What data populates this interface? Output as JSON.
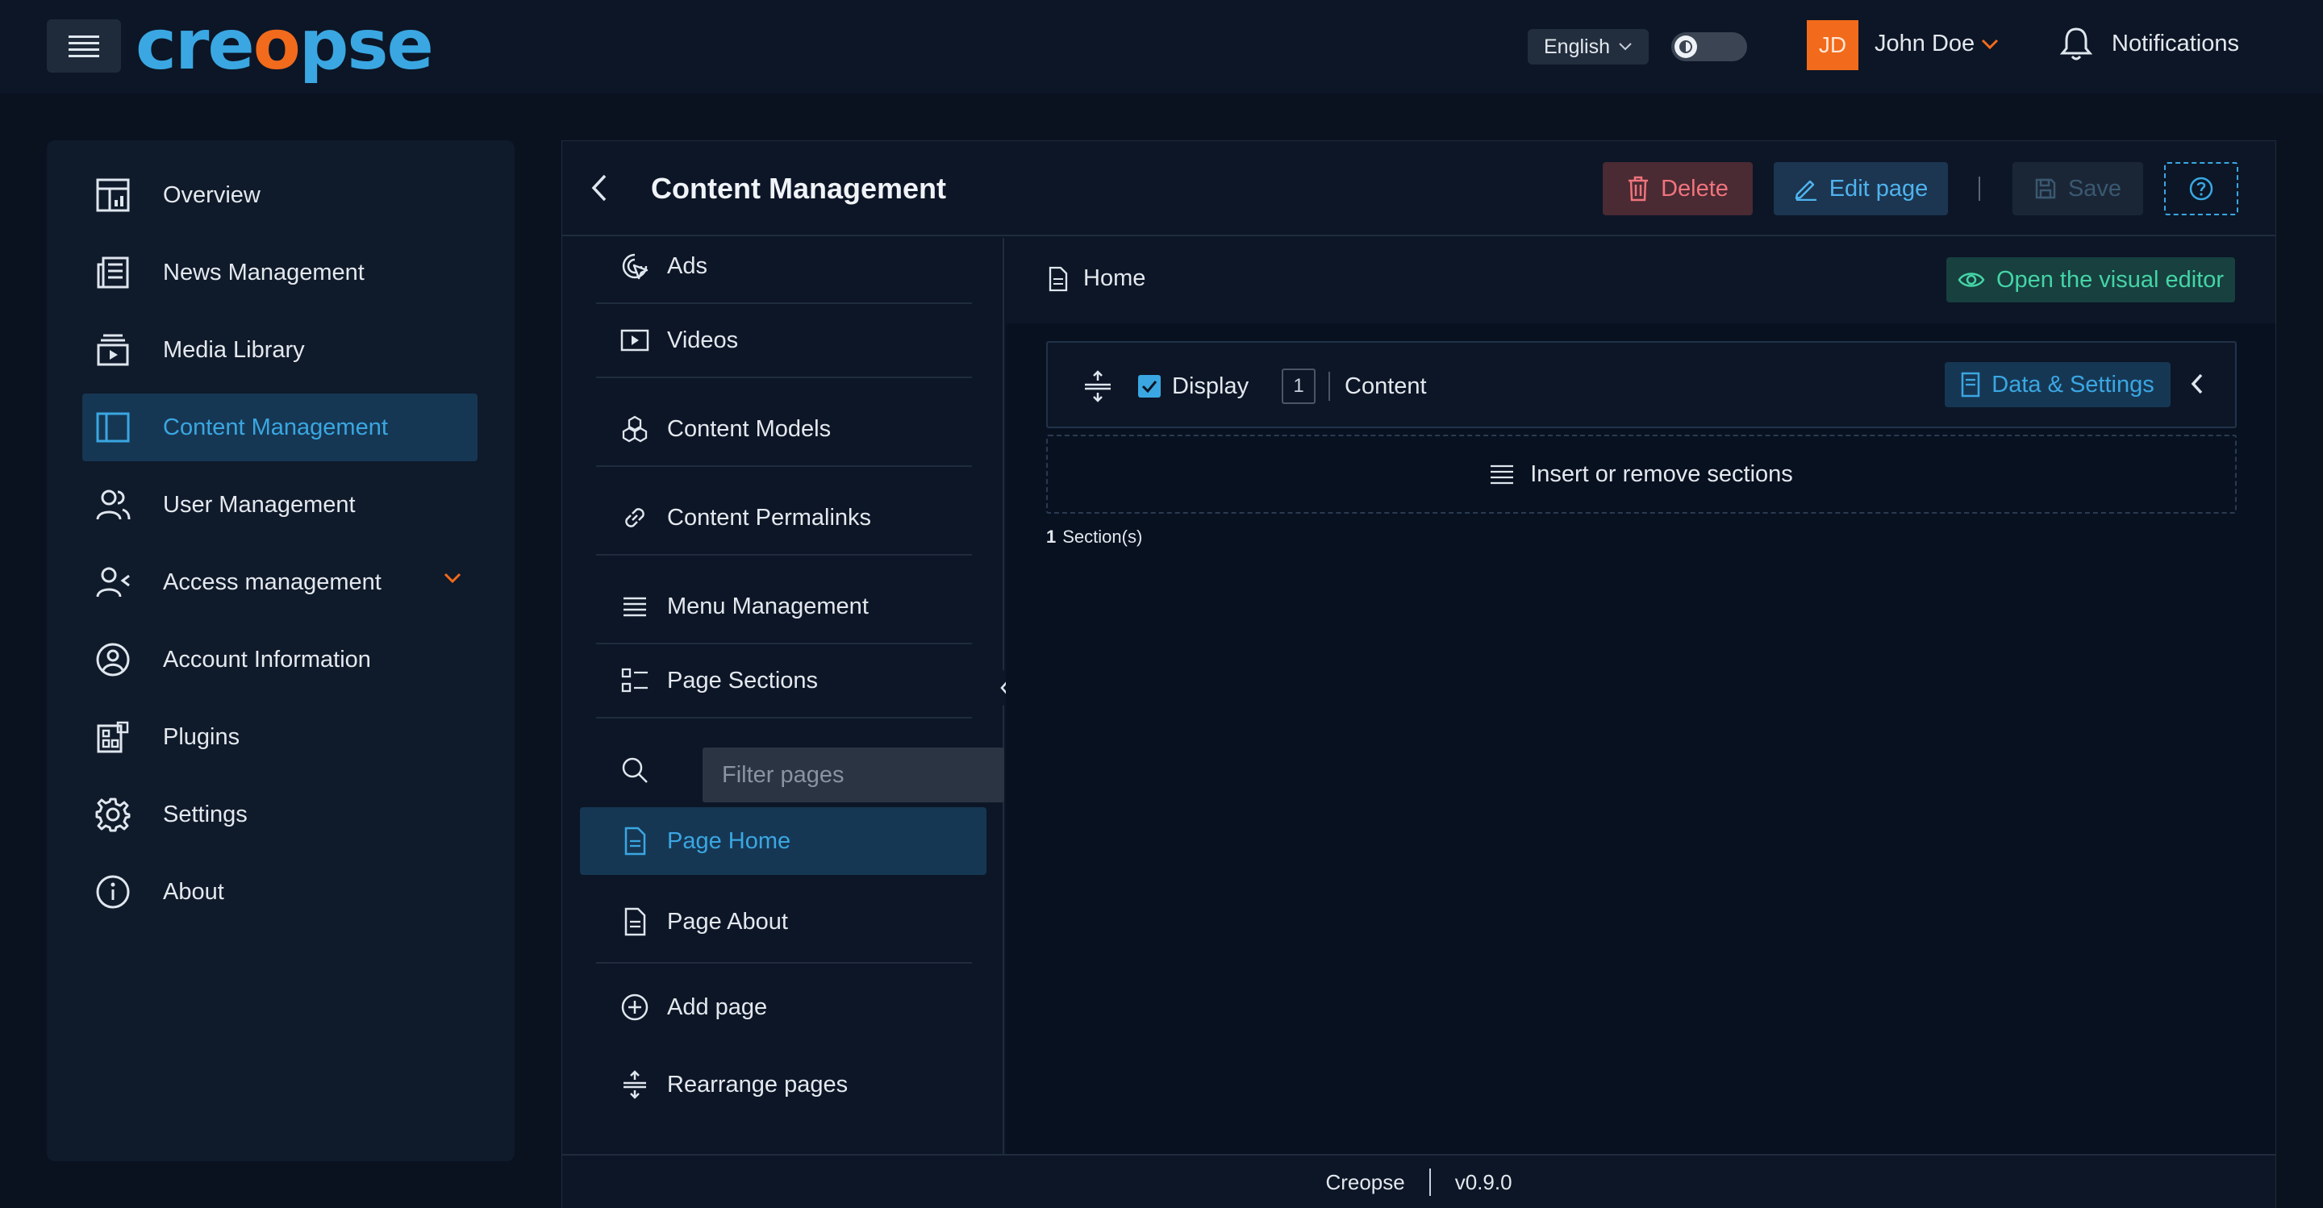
{
  "app": {
    "logo_prefix": "cre",
    "logo_mid": "o",
    "logo_suffix": "pse"
  },
  "header": {
    "language": "English",
    "user_initials": "JD",
    "user_name": "John Doe",
    "notifications_label": "Notifications"
  },
  "sidebar": {
    "items": [
      {
        "label": "Overview",
        "icon": "overview-icon"
      },
      {
        "label": "News Management",
        "icon": "news-icon"
      },
      {
        "label": "Media Library",
        "icon": "media-icon"
      },
      {
        "label": "Content Management",
        "icon": "content-icon",
        "active": true
      },
      {
        "label": "User Management",
        "icon": "users-icon"
      },
      {
        "label": "Access management",
        "icon": "access-icon",
        "expandable": true
      },
      {
        "label": "Account Information",
        "icon": "account-icon"
      },
      {
        "label": "Plugins",
        "icon": "plugins-icon"
      },
      {
        "label": "Settings",
        "icon": "gear-icon"
      },
      {
        "label": "About",
        "icon": "info-icon"
      }
    ]
  },
  "panel": {
    "title": "Content Management",
    "delete_label": "Delete",
    "edit_label": "Edit page",
    "save_label": "Save"
  },
  "subnav": {
    "items": [
      {
        "label": "Ads",
        "icon": "ads-icon"
      },
      {
        "label": "Videos",
        "icon": "video-icon"
      },
      {
        "label": "Content Models",
        "icon": "models-icon"
      },
      {
        "label": "Content Permalinks",
        "icon": "link-icon"
      },
      {
        "label": "Menu Management",
        "icon": "menu-lines-icon"
      },
      {
        "label": "Page Sections",
        "icon": "sections-icon"
      }
    ],
    "filter_placeholder": "Filter pages",
    "pages": [
      {
        "label": "Page Home",
        "active": true
      },
      {
        "label": "Page About"
      }
    ],
    "add_page_label": "Add page",
    "rearrange_label": "Rearrange pages"
  },
  "content": {
    "breadcrumb": "Home",
    "visual_editor_label": "Open the visual editor",
    "section": {
      "display_label": "Display",
      "display_checked": true,
      "index": "1",
      "name": "Content",
      "data_settings_label": "Data & Settings"
    },
    "insert_label": "Insert or remove sections",
    "section_count": "1",
    "section_count_suffix": "Section(s)"
  },
  "footer": {
    "brand": "Creopse",
    "version": "v0.9.0"
  },
  "colors": {
    "accent": "#3aa7e2",
    "brand_orange": "#f26a1b",
    "danger": "#f0747c",
    "success": "#45d4a6"
  }
}
